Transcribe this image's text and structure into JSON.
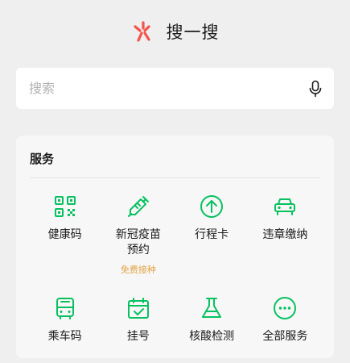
{
  "header": {
    "title": "搜一搜",
    "logo_icon": "sousou-logo-icon"
  },
  "search": {
    "placeholder": "搜索",
    "icon": "microphone-icon"
  },
  "services": {
    "title": "服务",
    "accent_color": "#07c160",
    "sub_color": "#e5a445",
    "items": [
      {
        "label": "健康码",
        "icon": "qr-code-icon"
      },
      {
        "label": "新冠疫苗\n预约",
        "icon": "syringe-icon",
        "sub": "免费接种"
      },
      {
        "label": "行程卡",
        "icon": "arrow-up-circle-icon"
      },
      {
        "label": "违章缴纳",
        "icon": "car-icon"
      },
      {
        "label": "乘车码",
        "icon": "bus-icon"
      },
      {
        "label": "挂号",
        "icon": "calendar-check-icon"
      },
      {
        "label": "核酸检测",
        "icon": "flask-icon"
      },
      {
        "label": "全部服务",
        "icon": "more-circle-icon"
      }
    ]
  }
}
